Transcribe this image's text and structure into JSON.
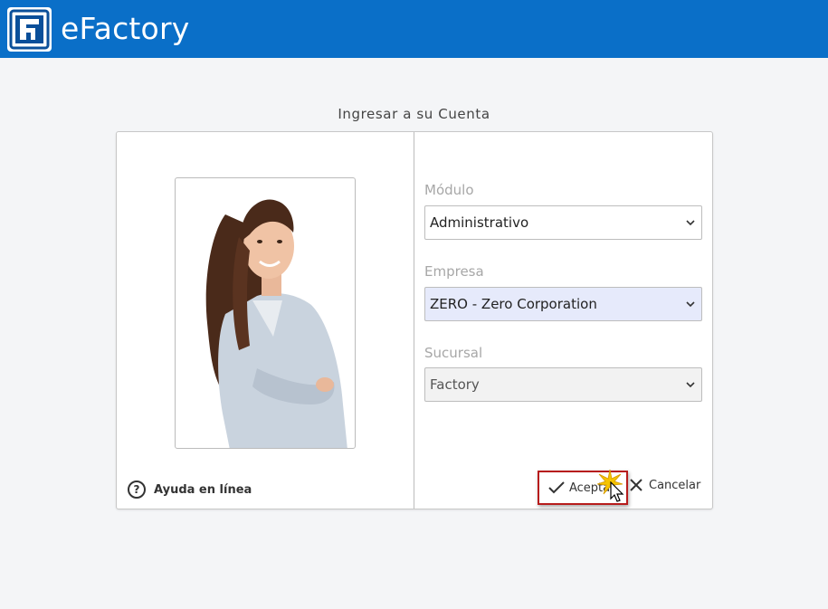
{
  "header": {
    "app_name": "eFactory",
    "logo_icon": "efactory-logo",
    "bar_color": "#0a6fc8"
  },
  "login": {
    "title": "Ingresar a su Cuenta",
    "photo": "user-photo",
    "help_label": "Ayuda en línea",
    "fields": {
      "modulo": {
        "label": "Módulo",
        "value": "Administrativo"
      },
      "empresa": {
        "label": "Empresa",
        "value": "ZERO - Zero Corporation"
      },
      "sucursal": {
        "label": "Sucursal",
        "value": "Factory"
      }
    },
    "accept_label": "Aceptar",
    "cancel_label": "Cancelar",
    "accent_border_color": "#b71c1c"
  }
}
